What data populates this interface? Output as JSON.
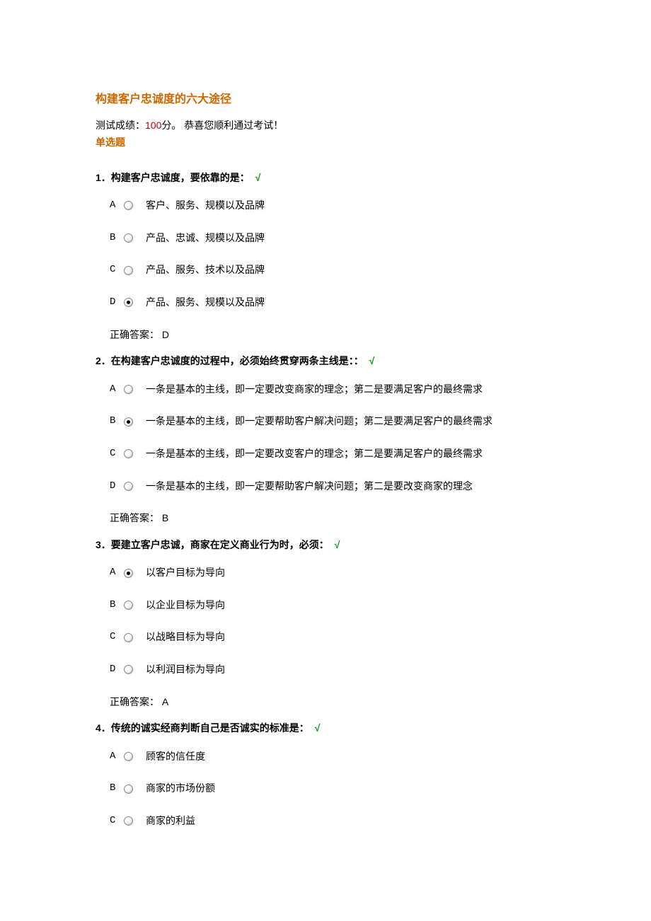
{
  "title": "构建客户忠诚度的六大途径",
  "score_prefix": "测试成绩：",
  "score_value": "100",
  "score_suffix": "分。  恭喜您顺利通过考试！",
  "section": "单选题",
  "check_mark": "√",
  "answer_label": "正确答案：",
  "questions": [
    {
      "num": "1．",
      "text": "构建客户忠诚度，要依靠的是：",
      "options": [
        {
          "letter": "A",
          "text": "客户、服务、规模以及品牌",
          "selected": false
        },
        {
          "letter": "B",
          "text": "产品、忠诚、规模以及品牌",
          "selected": false
        },
        {
          "letter": "C",
          "text": "产品、服务、技术以及品牌",
          "selected": false
        },
        {
          "letter": "D",
          "text": "产品、服务、规模以及品牌",
          "selected": true
        }
      ],
      "answer": " D"
    },
    {
      "num": "2．",
      "text": "在构建客户忠诚度的过程中，必须始终贯穿两条主线是：：",
      "options": [
        {
          "letter": "A",
          "text": "一条是基本的主线，即一定要改变商家的理念；第二是要满足客户的最终需求",
          "selected": false
        },
        {
          "letter": "B",
          "text": "一条是基本的主线，即一定要帮助客户解决问题；第二是要满足客户的最终需求",
          "selected": true
        },
        {
          "letter": "C",
          "text": "一条是基本的主线，即一定要改变客户的理念；第二是要满足客户的最终需求",
          "selected": false
        },
        {
          "letter": "D",
          "text": "一条是基本的主线，即一定要帮助客户解决问题；第二是要改变商家的理念",
          "selected": false
        }
      ],
      "answer": " B"
    },
    {
      "num": "3．",
      "text": "要建立客户忠诚，商家在定义商业行为时，必须：",
      "options": [
        {
          "letter": "A",
          "text": "以客户目标为导向",
          "selected": true
        },
        {
          "letter": "B",
          "text": "以企业目标为导向",
          "selected": false
        },
        {
          "letter": "C",
          "text": "以战略目标为导向",
          "selected": false
        },
        {
          "letter": "D",
          "text": "以利润目标为导向",
          "selected": false
        }
      ],
      "answer": " A"
    },
    {
      "num": "4．",
      "text": "传统的诚实经商判断自己是否诚实的标准是：",
      "options": [
        {
          "letter": "A",
          "text": "顾客的信任度",
          "selected": false
        },
        {
          "letter": "B",
          "text": "商家的市场份额",
          "selected": false
        },
        {
          "letter": "C",
          "text": "商家的利益",
          "selected": false
        }
      ],
      "answer": null
    }
  ]
}
